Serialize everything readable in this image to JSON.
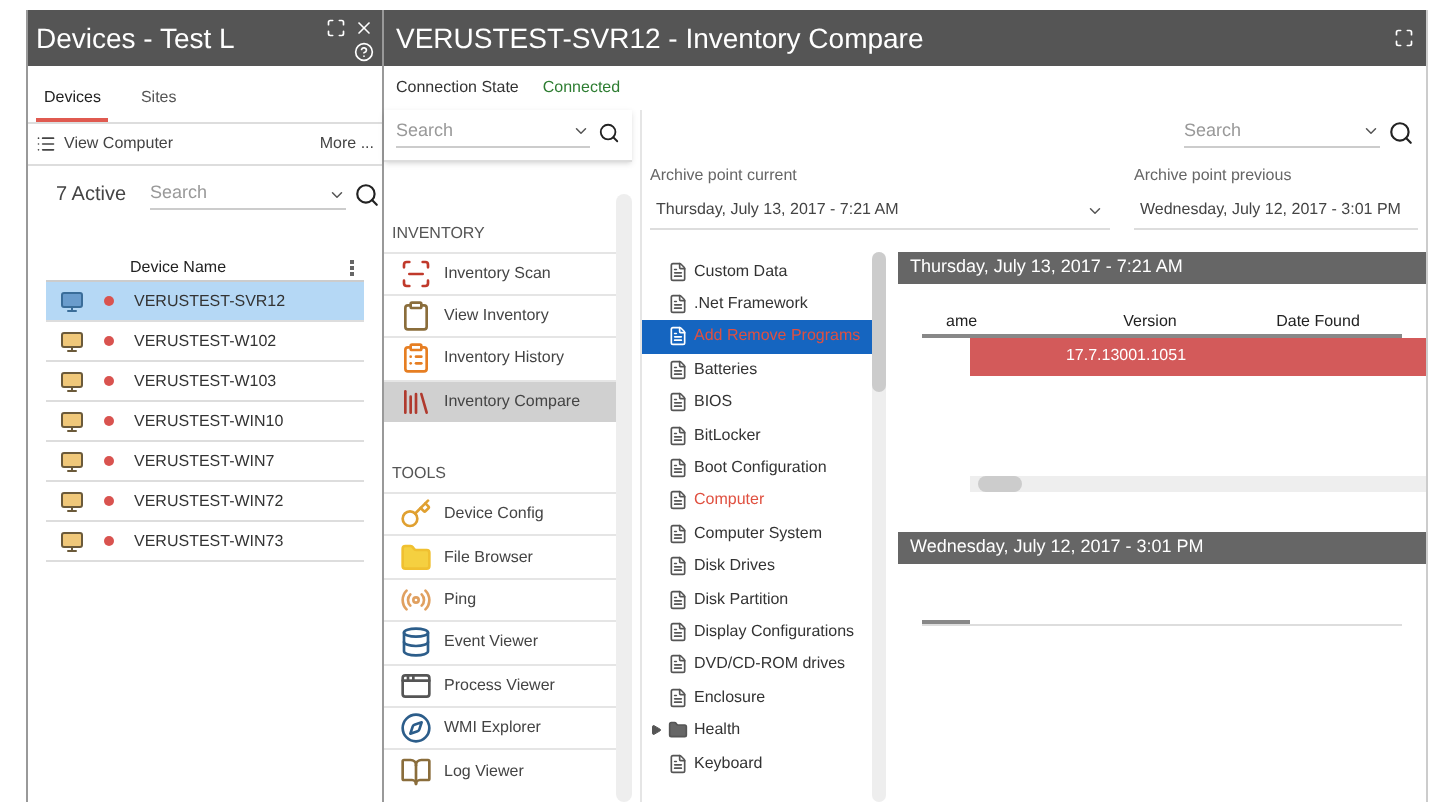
{
  "devices_window": {
    "title": "Devices - Test L",
    "tabs": [
      {
        "label": "Devices",
        "selected": true
      },
      {
        "label": "Sites",
        "selected": false
      }
    ],
    "toolbar": {
      "view_computer": "View Computer",
      "more": "More ..."
    },
    "active_count": "7 Active",
    "search": {
      "placeholder": "Search"
    },
    "table": {
      "column": "Device Name",
      "rows": [
        {
          "name": "VERUSTEST-SVR12",
          "selected": true,
          "color": "#d9534f"
        },
        {
          "name": "VERUSTEST-W102",
          "selected": false,
          "color": "#d9534f"
        },
        {
          "name": "VERUSTEST-W103",
          "selected": false,
          "color": "#d9534f"
        },
        {
          "name": "VERUSTEST-WIN10",
          "selected": false,
          "color": "#d9534f"
        },
        {
          "name": "VERUSTEST-WIN7",
          "selected": false,
          "color": "#d9534f"
        },
        {
          "name": "VERUSTEST-WIN72",
          "selected": false,
          "color": "#d9534f"
        },
        {
          "name": "VERUSTEST-WIN73",
          "selected": false,
          "color": "#d9534f"
        }
      ]
    }
  },
  "compare_window": {
    "title": "VERUSTEST-SVR12 - Inventory Compare",
    "connection_label": "Connection State",
    "connection_value": "Connected",
    "nav_search": {
      "placeholder": "Search"
    },
    "nav_groups": [
      {
        "label": "INVENTORY",
        "items": [
          {
            "label": "Inventory Scan",
            "selected": false
          },
          {
            "label": "View Inventory",
            "selected": false
          },
          {
            "label": "Inventory History",
            "selected": false
          },
          {
            "label": "Inventory Compare",
            "selected": true
          }
        ]
      },
      {
        "label": "TOOLS",
        "items": [
          {
            "label": "Device Config",
            "selected": false
          },
          {
            "label": "File Browser",
            "selected": false
          },
          {
            "label": "Ping",
            "selected": false
          },
          {
            "label": "Event Viewer",
            "selected": false
          },
          {
            "label": "Process Viewer",
            "selected": false
          },
          {
            "label": "WMI Explorer",
            "selected": false
          },
          {
            "label": "Log Viewer",
            "selected": false
          }
        ]
      }
    ],
    "search": {
      "placeholder": "Search"
    },
    "archive_current": {
      "label": "Archive point current",
      "value": "Thursday, July 13, 2017 - 7:21 AM"
    },
    "archive_previous": {
      "label": "Archive point previous",
      "value": "Wednesday, July 12, 2017 - 3:01 PM"
    },
    "tree": [
      {
        "label": "Custom Data",
        "kind": "file",
        "selected": false,
        "changed": false
      },
      {
        "label": ".Net Framework",
        "kind": "file",
        "selected": false,
        "changed": false
      },
      {
        "label": "Add Remove Programs",
        "kind": "file",
        "selected": true,
        "changed": true
      },
      {
        "label": "Batteries",
        "kind": "file",
        "selected": false,
        "changed": false
      },
      {
        "label": "BIOS",
        "kind": "file",
        "selected": false,
        "changed": false
      },
      {
        "label": "BitLocker",
        "kind": "file",
        "selected": false,
        "changed": false
      },
      {
        "label": "Boot Configuration",
        "kind": "file",
        "selected": false,
        "changed": false
      },
      {
        "label": "Computer",
        "kind": "file",
        "selected": false,
        "changed": true
      },
      {
        "label": "Computer System",
        "kind": "file",
        "selected": false,
        "changed": false
      },
      {
        "label": "Disk Drives",
        "kind": "file",
        "selected": false,
        "changed": false
      },
      {
        "label": "Disk Partition",
        "kind": "file",
        "selected": false,
        "changed": false
      },
      {
        "label": "Display Configurations",
        "kind": "file",
        "selected": false,
        "changed": false
      },
      {
        "label": "DVD/CD-ROM drives",
        "kind": "file",
        "selected": false,
        "changed": false
      },
      {
        "label": "Enclosure",
        "kind": "file",
        "selected": false,
        "changed": false
      },
      {
        "label": "Health",
        "kind": "folder",
        "selected": false,
        "changed": false
      },
      {
        "label": "Keyboard",
        "kind": "file",
        "selected": false,
        "changed": false
      }
    ],
    "current_panel": {
      "title": "Thursday, July 13, 2017 - 7:21 AM",
      "columns": [
        "ame",
        "Version",
        "Date Found"
      ],
      "rows": [
        {
          "cells": [
            "",
            "17.7.13001.1051",
            ""
          ],
          "changed": true
        }
      ]
    },
    "previous_panel": {
      "title": "Wednesday, July 12, 2017 - 3:01 PM"
    }
  }
}
